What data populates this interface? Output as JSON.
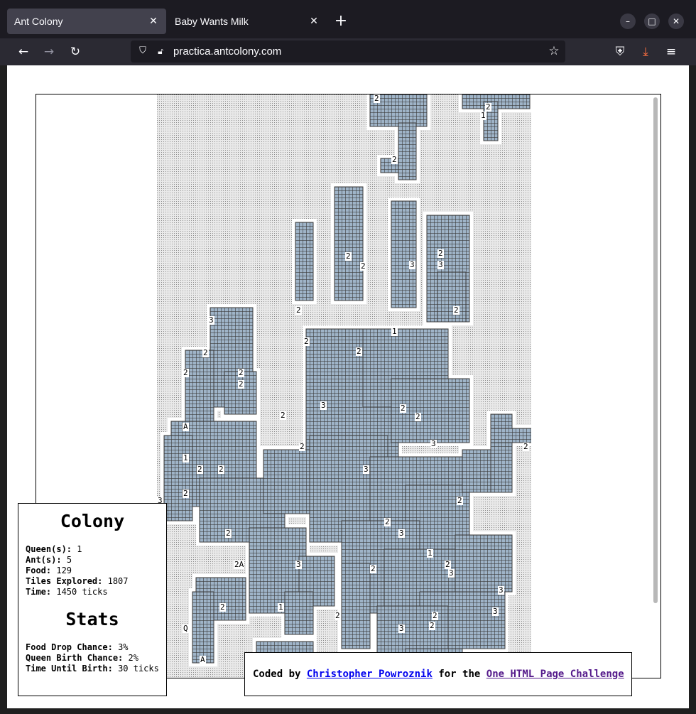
{
  "browser": {
    "tabs": [
      {
        "title": "Ant Colony",
        "active": true
      },
      {
        "title": "Baby Wants Milk",
        "active": false
      }
    ],
    "url": "practica.antcolony.com",
    "icons": [
      "back-icon",
      "forward-icon",
      "reload-icon",
      "shield-icon",
      "lock-icon",
      "star-icon",
      "pocket-icon",
      "download-icon",
      "menu-icon",
      "minimize-icon",
      "maximize-icon",
      "close-icon"
    ],
    "colors": {
      "tabbar": "#1c1b22",
      "toolbar": "#2b2a33",
      "active_tab": "#42414d",
      "download_accent": "#ff6f40"
    }
  },
  "game": {
    "colors": {
      "dirt": "#c8c8c8",
      "tunnel_wall": "#3c3c3c",
      "tunnel_floor": "#ffffff",
      "tunnel_fill": "#9fb4c8"
    },
    "markers": [
      "2",
      "2",
      "1",
      "2",
      "2",
      "2",
      "3",
      "2",
      "3",
      "2",
      "2",
      "1",
      "2",
      "2",
      "3",
      "2",
      "2",
      "2",
      "2",
      "2",
      "3",
      "2",
      "2",
      "3",
      "2",
      "3",
      "A",
      "2",
      "1",
      "2",
      "2",
      "2",
      "2",
      "2",
      "3",
      "3",
      "2",
      "2",
      "3",
      "1",
      "2",
      "2A",
      "3",
      "3",
      "2",
      "2",
      "1",
      "2",
      "3",
      "Q",
      "3",
      "2",
      "A"
    ]
  },
  "colony": {
    "heading": "Colony",
    "queens_label": "Queen(s):",
    "queens": "1",
    "ants_label": "Ant(s):",
    "ants": "5",
    "food_label": "Food:",
    "food": "129",
    "tiles_label": "Tiles Explored:",
    "tiles": "1807",
    "time_label": "Time:",
    "time": "1450 ticks"
  },
  "stats": {
    "heading": "Stats",
    "food_drop_label": "Food Drop Chance:",
    "food_drop": "3%",
    "queen_birth_label": "Queen Birth Chance:",
    "queen_birth": "2%",
    "until_birth_label": "Time Until Birth:",
    "until_birth": "30 ticks"
  },
  "credit": {
    "prefix": "Coded by",
    "author": "Christopher Powroznik",
    "middle": "for the",
    "challenge": "One HTML Page Challenge"
  }
}
